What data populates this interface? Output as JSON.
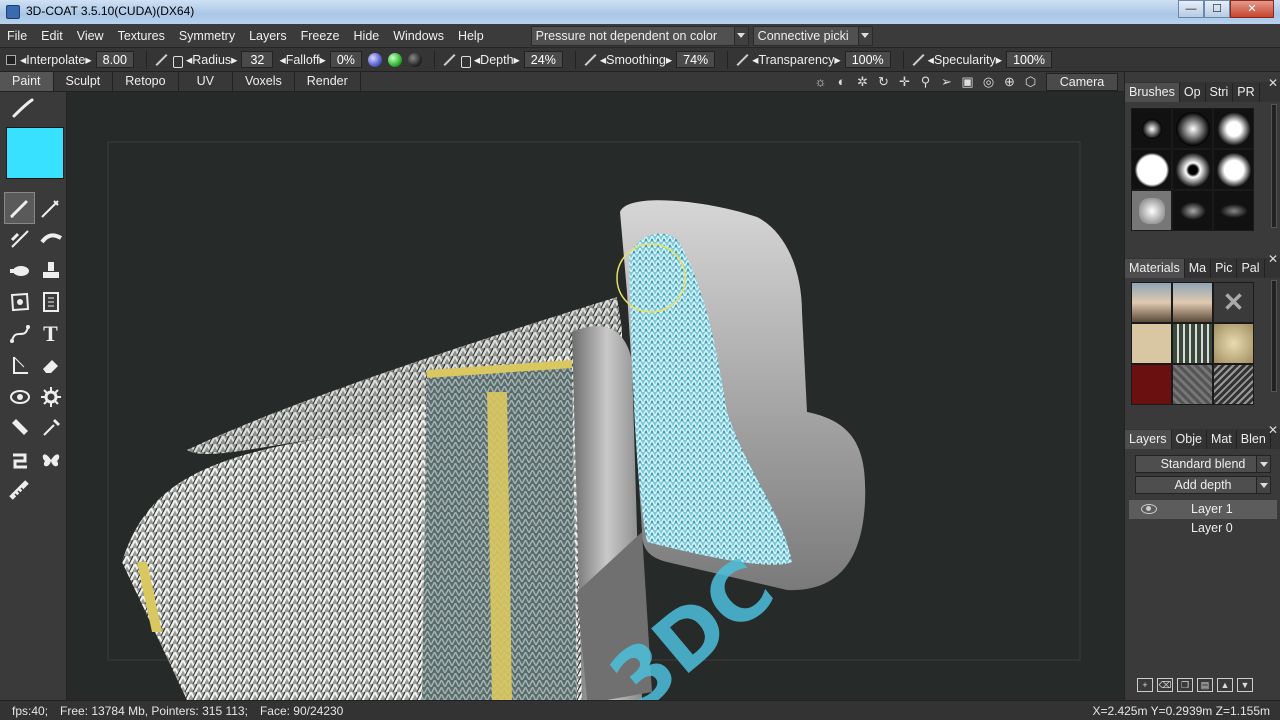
{
  "window": {
    "title": "3D-COAT 3.5.10(CUDA)(DX64)",
    "minimize": "—",
    "maximize": "☐",
    "close": "✕"
  },
  "menu": {
    "items": [
      "File",
      "Edit",
      "View",
      "Textures",
      "Symmetry",
      "Layers",
      "Freeze",
      "Hide",
      "Windows",
      "Help"
    ],
    "pressure_dropdown": "Pressure not dependent on color",
    "pick_dropdown": "Connective picki"
  },
  "options": {
    "interpolate_label": "◂Interpolate▸",
    "interpolate_value": "8.00",
    "radius_label": "◂Radius▸",
    "radius_value": "32",
    "falloff_label": "◂Falloff▸",
    "falloff_value": "0%",
    "depth_label": "◂Depth▸",
    "depth_value": "24%",
    "smoothing_label": "◂Smoothing▸",
    "smoothing_value": "74%",
    "transparency_label": "◂Transparency▸",
    "transparency_value": "100%",
    "specularity_label": "◂Specularity▸",
    "specularity_value": "100%"
  },
  "rooms": {
    "tabs": [
      "Paint",
      "Sculpt",
      "Retopo",
      "UV",
      "Voxels",
      "Render"
    ],
    "active": "Paint",
    "camera": "Camera",
    "view_tools": [
      "☼",
      "◐",
      "✲",
      "↻",
      "✛",
      "⚲",
      "➢",
      "▣",
      "◎",
      "⊕",
      "⬡"
    ]
  },
  "toolbox": {
    "color": "#38e1ff",
    "tools": [
      "brush-icon",
      "pen-icon",
      "line-brush-icon",
      "smudge-icon",
      "airbrush-icon",
      "stamp-icon",
      "lasso-icon",
      "copy-icon",
      "curve-icon",
      "text-icon",
      "fill-icon",
      "eraser-icon",
      "eye-icon",
      "gear-icon",
      "tube-icon",
      "eyedropper-icon",
      "magnet-icon",
      "butterfly-icon",
      "ruler-icon"
    ]
  },
  "panels": {
    "brushes": {
      "tabs": [
        "Brushes",
        "Op",
        "Stri",
        "PR"
      ]
    },
    "materials": {
      "tabs": [
        "Materials",
        "Ma",
        "Pic",
        "Pal"
      ]
    },
    "layers": {
      "tabs": [
        "Layers",
        "Obje",
        "Mat",
        "Blen"
      ],
      "blend": "Standard blend",
      "depth_mode": "Add depth",
      "items": [
        "Layer 1",
        "Layer 0"
      ],
      "active": "Layer 1"
    }
  },
  "status": {
    "fps": "fps:40;",
    "memory": "Free: 13784 Mb, Pointers: 315 113;",
    "face": "Face: 90/24230",
    "coords": "X=2.425m Y=0.2939m Z=1.155m"
  },
  "viewport_text": "3DC"
}
